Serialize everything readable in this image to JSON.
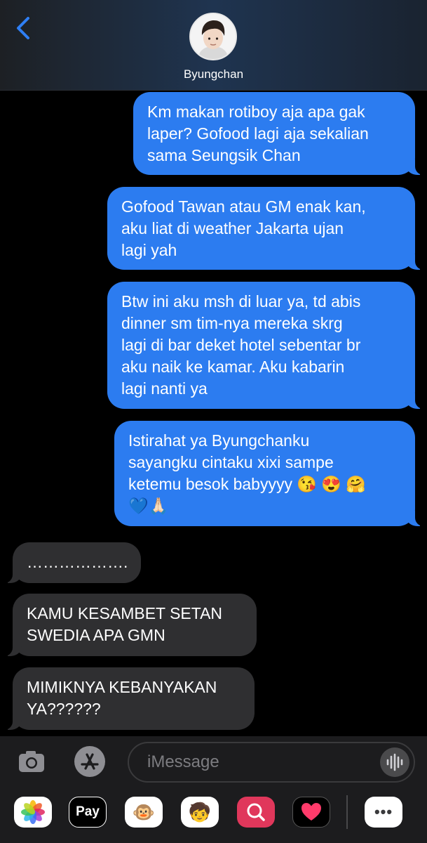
{
  "header": {
    "contact_name": "Byungchan"
  },
  "messages": [
    {
      "direction": "sent",
      "lines": [
        "Km makan rotiboy aja apa gak",
        "laper? Gofood lagi aja sekalian",
        "sama Seungsik Chan"
      ]
    },
    {
      "direction": "sent",
      "lines": [
        "Gofood Tawan atau GM enak kan,",
        "aku liat di weather Jakarta ujan",
        "lagi yah"
      ]
    },
    {
      "direction": "sent",
      "lines": [
        "Btw ini aku msh di luar ya, td abis",
        "dinner sm tim-nya mereka skrg",
        "lagi di bar deket hotel sebentar br",
        "aku naik ke kamar. Aku kabarin",
        "lagi nanti ya"
      ]
    },
    {
      "direction": "sent",
      "lines": [
        "Istirahat ya Byungchanku",
        "sayangku cintaku xixi sampe",
        "ketemu besok babyyyy 😘 😍 🤗",
        "💙🙏🏻"
      ]
    },
    {
      "direction": "received",
      "lines": [
        "………………."
      ]
    },
    {
      "direction": "received",
      "lines": [
        "KAMU KESAMBET SETAN",
        "SWEDIA APA GMN"
      ]
    },
    {
      "direction": "received",
      "lines": [
        "MIMIKNYA KEBANYAKAN",
        "YA??????"
      ]
    }
  ],
  "input": {
    "placeholder": "iMessage"
  },
  "app_drawer": {
    "items": [
      {
        "name": "photos-icon",
        "glyph": "🌸"
      },
      {
        "name": "apple-pay-icon",
        "glyph": "Pay"
      },
      {
        "name": "animoji-icon",
        "glyph": "🐵"
      },
      {
        "name": "memoji-icon",
        "glyph": "🧒"
      },
      {
        "name": "search-images-icon",
        "glyph": "🔍"
      },
      {
        "name": "digital-touch-icon",
        "glyph": "💗"
      },
      {
        "name": "more-apps-icon",
        "glyph": "•••"
      }
    ]
  },
  "colors": {
    "sent_bubble": "#2c7cf0",
    "received_bubble": "#2f2f31",
    "accent": "#2f7ff5"
  }
}
